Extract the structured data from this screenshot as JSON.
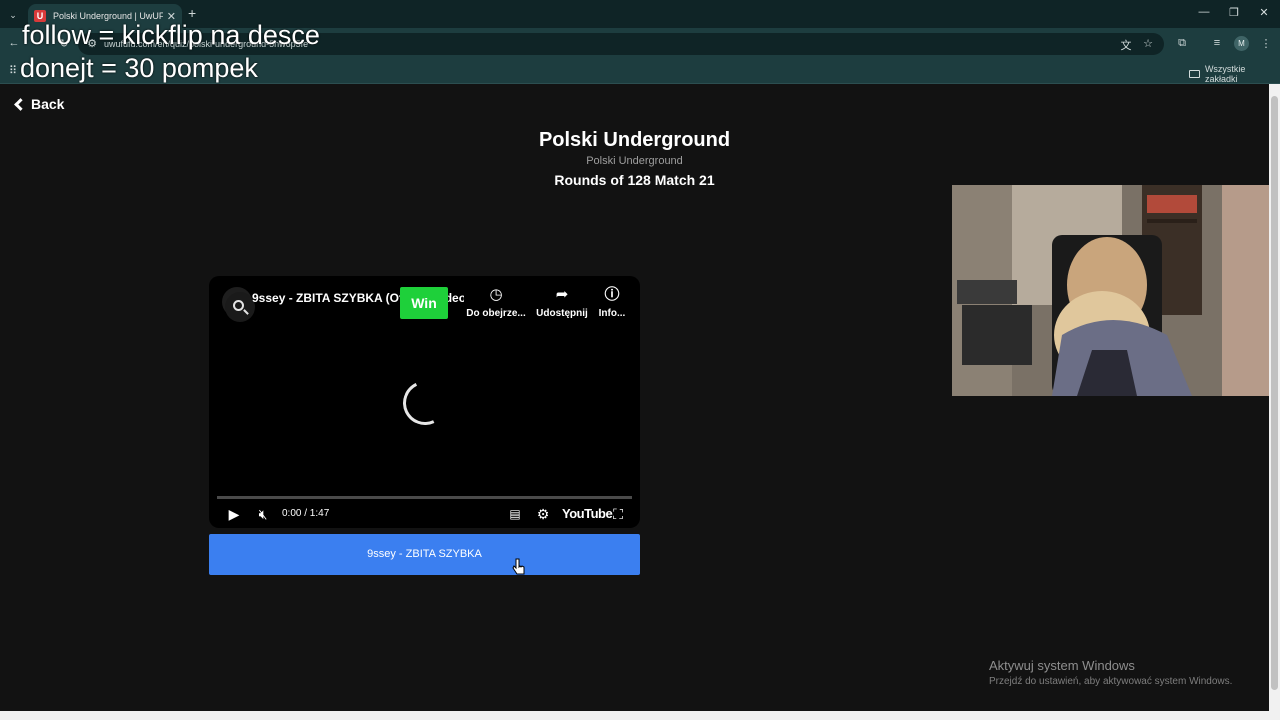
{
  "browser": {
    "tab_title": "Polski Underground | UwUFUFU",
    "tab_favicon_letter": "U",
    "url": "uwufufu.com/en/quiz/polski-underground-5nw6p5fe",
    "avatar_letter": "M",
    "bookmarks_all": "Wszystkie zakładki"
  },
  "overlay": {
    "line1": "follow = kickflip na desce",
    "line2": "donejt = 30 pompek"
  },
  "page": {
    "back_label": "Back",
    "title": "Polski Underground",
    "subtitle": "Polski Underground",
    "round_info": "Rounds of 128 Match 21"
  },
  "player": {
    "video_title": "9ssey - ZBITA SZYBKA (Official Video)",
    "win_label": "Win",
    "watch_later_label": "Do obejrze...",
    "share_label": "Udostępnij",
    "info_label": "Info...",
    "time": "0:00 / 1:47",
    "youtube_label": "YouTube",
    "progress": 0
  },
  "choice_button": "9ssey - ZBITA SZYBKA",
  "watermark": {
    "title": "Aktywuj system Windows",
    "subtitle": "Przejdź do ustawień, aby aktywować system Windows."
  },
  "colors": {
    "page_bg": "#121212",
    "chrome_bg": "#1d3d3f",
    "win_green": "#1ed03a",
    "choice_blue": "#3b7ff0"
  }
}
